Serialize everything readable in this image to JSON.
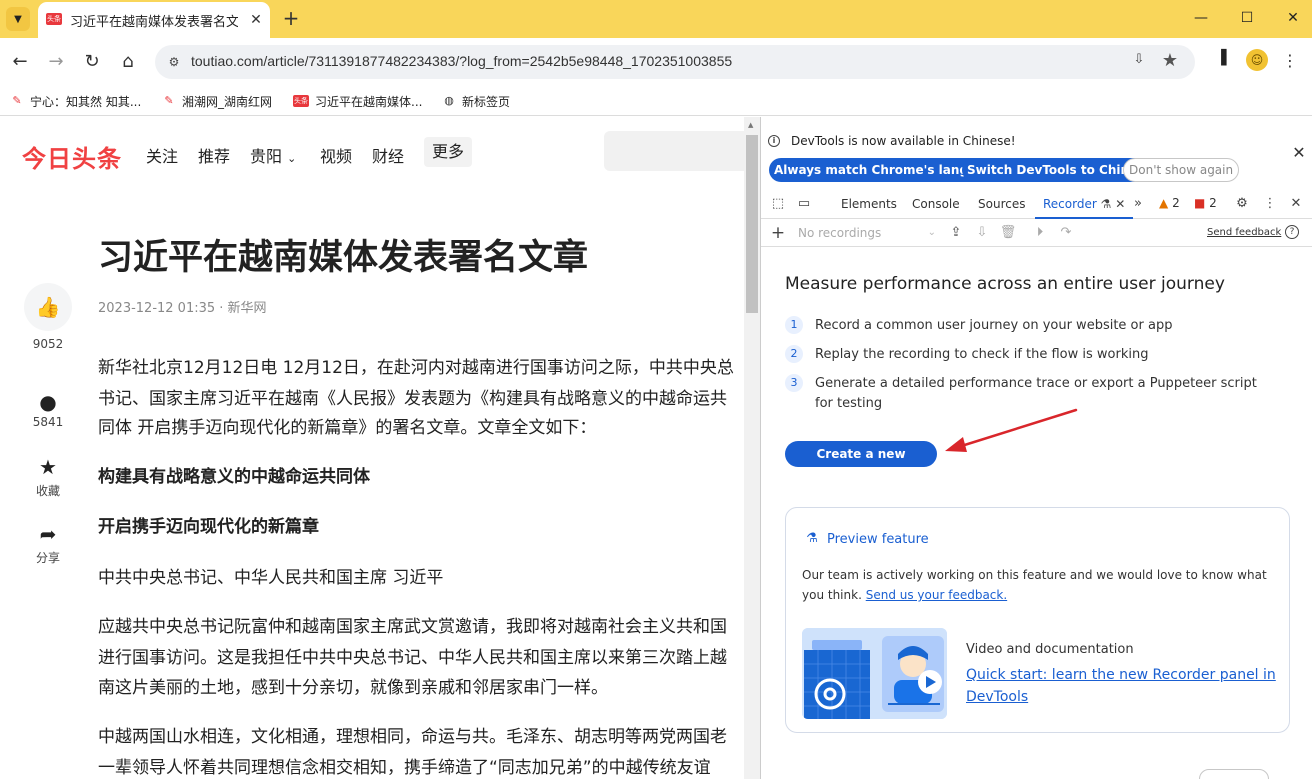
{
  "browser": {
    "tab": {
      "favicon_text": "头条",
      "title": "习近平在越南媒体发表署名文章"
    },
    "url": "toutiao.com/article/7311391877482234383/?log_from=2542b5e98448_1702351003855",
    "profile_initial": "☺",
    "bookmarks": [
      {
        "label": "宁心：知其然 知其..."
      },
      {
        "label": "湘潮网_湖南红网"
      },
      {
        "label": "习近平在越南媒体..."
      },
      {
        "label": "新标签页"
      }
    ]
  },
  "page": {
    "logo": "今日头条",
    "nav": [
      "关注",
      "推荐",
      "贵阳",
      "视频",
      "财经"
    ],
    "nav_more": "更多",
    "article": {
      "title": "习近平在越南媒体发表署名文章",
      "meta": "2023-12-12 01:35 · 新华网",
      "paragraphs": [
        "新华社北京12月12日电 12月12日，在赴河内对越南进行国事访问之际，中共中央总",
        "书记、国家主席习近平在越南《人民报》发表题为《构建具有战略意义的中越命运共",
        "同体 开启携手迈向现代化的新篇章》的署名文章。文章全文如下：",
        "构建具有战略意义的中越命运共同体",
        "开启携手迈向现代化的新篇章",
        "中共中央总书记、中华人民共和国主席 习近平",
        "应越共中央总书记阮富仲和越南国家主席武文赏邀请，我即将对越南社会主义共和国",
        "进行国事访问。这是我担任中共中央总书记、中华人民共和国主席以来第三次踏上越",
        "南这片美丽的土地，感到十分亲切，就像到亲戚和邻居家串门一样。",
        "中越两国山水相连，文化相通，理想相同，命运与共。毛泽东、胡志明等两党两国老",
        "一辈领导人怀着共同理想信念相交相知，携手缔造了“同志加兄弟”的中越传统友谊"
      ]
    },
    "actions": {
      "like_count": "9052",
      "comment_count": "5841",
      "favorite_label": "收藏",
      "share_label": "分享"
    }
  },
  "devtools": {
    "infobar": {
      "message": "DevTools is now available in Chinese!",
      "btn_match": "Always match Chrome's language",
      "btn_switch": "Switch DevTools to Chinese",
      "btn_dismiss": "Don't show again"
    },
    "tabs": [
      "Elements",
      "Console",
      "Sources",
      "Recorder"
    ],
    "warning_count": "2",
    "error_count": "2",
    "recordings_placeholder": "No recordings",
    "send_feedback": "Send feedback",
    "recorder": {
      "heading": "Measure performance across an entire user journey",
      "steps": [
        {
          "num": "1",
          "text": "Record a common user journey on your website or app"
        },
        {
          "num": "2",
          "text": "Replay the recording to check if the flow is working"
        },
        {
          "num": "3",
          "text": "Generate a detailed performance trace or export a Puppeteer script for testing"
        }
      ],
      "create_button": "Create a new recording",
      "preview": {
        "title": "Preview feature",
        "body": "Our team is actively working on this feature and we would love to know what you think.",
        "link": "Send us your feedback.",
        "video_title": "Video and documentation",
        "video_link": "Quick start: learn the new Recorder panel in DevTools"
      }
    }
  }
}
